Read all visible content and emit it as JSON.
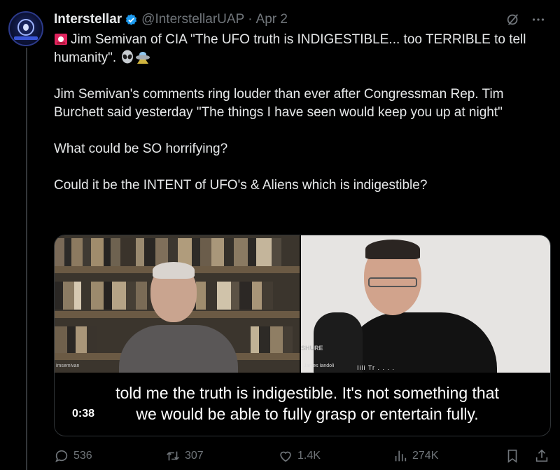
{
  "author": {
    "name": "Interstellar",
    "handle": "@InterstellarUAP",
    "separator": "·",
    "date": "Apr 2"
  },
  "tweet": {
    "line1": "Jim Semivan of CIA  \"The UFO truth is INDIGESTIBLE... too TERRIBLE to tell humanity\".",
    "para2": "Jim Semivan's comments ring louder than ever after Congressman Rep. Tim Burchett said yesterday  \"The things I have seen would keep you up at night\"",
    "para3": "What could be SO horrifying?",
    "para4": "Could it be the INTENT of UFO's & Aliens which is indigestible?"
  },
  "video": {
    "caption_line1": "told me the truth is indigestible. It's not something that",
    "caption_line2": "we would be able to fully grasp or entertain fully.",
    "timestamp": "0:38",
    "left_name_tag": "imsemivan",
    "right_name_tag": "James Iandoli",
    "mic_brand": "SHURE",
    "shirt_text": "Iili Tr . . . ."
  },
  "actions": {
    "replies": "536",
    "reposts": "307",
    "likes": "1.4K",
    "views": "274K"
  },
  "colors": {
    "background": "#000000",
    "text": "#e7e9ea",
    "muted": "#71767b",
    "verified": "#1d9bf0",
    "siren": "#e0245e"
  },
  "icons": [
    "grok-icon",
    "more-icon",
    "reply-icon",
    "repost-icon",
    "like-icon",
    "views-icon",
    "bookmark-icon",
    "share-icon",
    "siren-icon",
    "alien-icon",
    "ufo-icon",
    "verified-icon"
  ]
}
